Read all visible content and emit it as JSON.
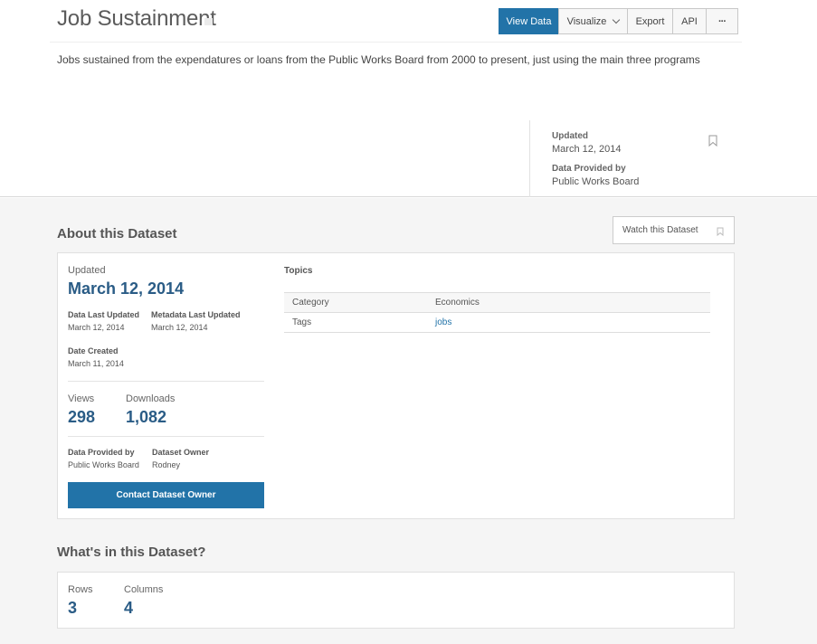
{
  "header": {
    "title": "Job Sustainment",
    "description": "Jobs sustained from the expendatures or loans from the Public Works Board from 2000 to present, just using the main three programs"
  },
  "actions": {
    "view_data": "View Data",
    "visualize": "Visualize",
    "export": "Export",
    "api": "API",
    "more": "···"
  },
  "meta": {
    "updated_label": "Updated",
    "updated_value": "March 12, 2014",
    "provided_label": "Data Provided by",
    "provided_value": "Public Works Board"
  },
  "about": {
    "title": "About this Dataset",
    "watch_label": "Watch this Dataset",
    "updated_label": "Updated",
    "updated_value": "March 12, 2014",
    "data_last_updated_label": "Data Last Updated",
    "data_last_updated_value": "March 12, 2014",
    "metadata_last_updated_label": "Metadata Last Updated",
    "metadata_last_updated_value": "March 12, 2014",
    "date_created_label": "Date Created",
    "date_created_value": "March 11, 2014",
    "views_label": "Views",
    "views_value": "298",
    "downloads_label": "Downloads",
    "downloads_value": "1,082",
    "provided_label": "Data Provided by",
    "provided_value": "Public Works Board",
    "owner_label": "Dataset Owner",
    "owner_value": "Rodney",
    "contact_button": "Contact Dataset Owner",
    "topics_title": "Topics",
    "topics": [
      {
        "key": "Category",
        "value": "Economics"
      },
      {
        "key": "Tags",
        "value": "jobs"
      }
    ]
  },
  "contents": {
    "title": "What's in this Dataset?",
    "rows_label": "Rows",
    "rows_value": "3",
    "columns_label": "Columns",
    "columns_value": "4"
  },
  "icons": {
    "bookmark": "bookmark-icon",
    "chevron": "chevron-down-icon"
  },
  "colors": {
    "accent": "#2273a8",
    "number": "#2a5c86",
    "background": "#f5f5f5"
  }
}
